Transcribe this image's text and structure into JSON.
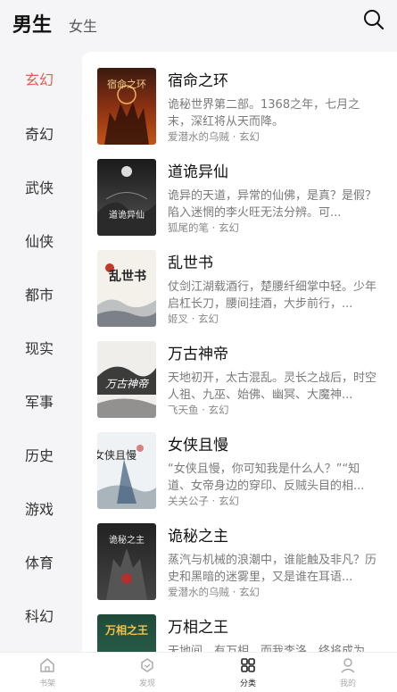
{
  "header": {
    "tabs": [
      "男生",
      "女生"
    ],
    "search_icon": "search-icon"
  },
  "sidebar": {
    "active_index": 0,
    "active_color": "#e85a4f",
    "categories": [
      "玄幻",
      "奇幻",
      "武侠",
      "仙侠",
      "都市",
      "现实",
      "军事",
      "历史",
      "游戏",
      "体育",
      "科幻"
    ]
  },
  "books": [
    {
      "title": "宿命之环",
      "desc": "诡秘世界第二部。1368之年，七月之末，深红将从天而降。",
      "meta": "爱潜水的乌贼 · 玄幻",
      "cover_text": "宿命之环"
    },
    {
      "title": "道诡异仙",
      "desc": "诡异的天道，异常的仙佛，是真？是假？陷入迷惘的李火旺无法分辨。可...",
      "meta": "狐尾的笔 · 玄幻",
      "cover_text": "道诡异仙"
    },
    {
      "title": "乱世书",
      "desc": "仗剑江湖载酒行，楚腰纤细掌中轻。少年启杠长刀，腰间挂酒，大步前行，...",
      "meta": "姬叉 · 玄幻",
      "cover_text": "乱世书"
    },
    {
      "title": "万古神帝",
      "desc": "天地初开，太古混乱。灵长之战后，时空人祖、九巫、始佛、幽冥、大魔神...",
      "meta": "飞天鱼 · 玄幻",
      "cover_text": "万古神帝"
    },
    {
      "title": "女侠且慢",
      "desc": "“女侠且慢，你可知我是什么人？”“知道、女帝身边的穿印、反贼头目的相...",
      "meta": "关关公子 · 玄幻",
      "cover_text": "女侠且慢"
    },
    {
      "title": "诡秘之主",
      "desc": "蒸汽与机械的浪潮中，谁能触及非凡？历史和黑暗的迷雾里，又是谁在耳语...",
      "meta": "爱潜水的乌贼 · 玄幻",
      "cover_text": "诡秘之主"
    },
    {
      "title": "万相之王",
      "desc": "天地间，有万相。而我李洛，终将成为...",
      "meta": "",
      "cover_text": "万相之王"
    }
  ],
  "bottom_nav": {
    "active_index": 2,
    "items": [
      {
        "label": "书架",
        "icon": "bookshelf-icon"
      },
      {
        "label": "发现",
        "icon": "discover-icon"
      },
      {
        "label": "分类",
        "icon": "category-icon"
      },
      {
        "label": "我的",
        "icon": "profile-icon"
      }
    ]
  }
}
